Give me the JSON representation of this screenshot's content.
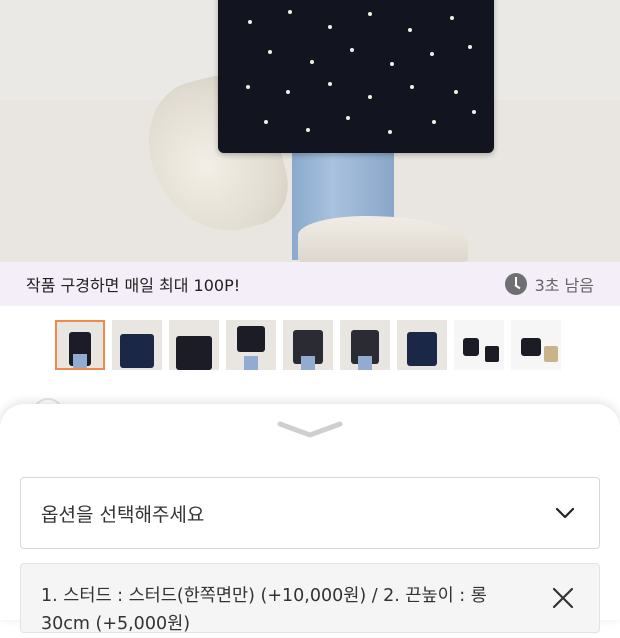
{
  "banner": {
    "message": "작품 구경하면 매일 최대 100P!",
    "timer_text": "3초 남음",
    "clock_icon": "clock-icon"
  },
  "gallery": {
    "thumbnail_count": 9,
    "selected_index": 0
  },
  "option_sheet": {
    "select_placeholder": "옵션을 선택해주세요",
    "selected_option_text": "1. 스터드 : 스터드(한쪽면만) (+10,000원) / 2. 끈높이 : 롱 30cm (+5,000원)",
    "icons": {
      "handle": "chevron-down-icon",
      "dropdown": "chevron-down-icon",
      "remove": "close-icon"
    }
  },
  "colors": {
    "banner_bg": "#f3eef8",
    "thumb_selected_border": "#f08a4b"
  }
}
